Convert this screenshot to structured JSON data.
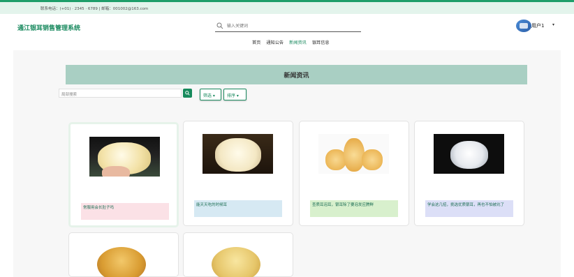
{
  "topbar": {
    "contact": "联系电话：(+01) · 2345 · 6789 | 邮箱：001002@163.com"
  },
  "header": {
    "brand": "通江银耳销售管理系统",
    "search_placeholder": "输入关键词",
    "username": "用户1",
    "caret": "▾"
  },
  "nav": {
    "items": [
      {
        "label": "首页",
        "active": false
      },
      {
        "label": "通知公告",
        "active": false
      },
      {
        "label": "新闻资讯",
        "active": true
      },
      {
        "label": "银耳信息",
        "active": false
      }
    ]
  },
  "page": {
    "title": "新闻资讯",
    "filter_value": "局部搜索",
    "filter_btn": "筛选 ▾",
    "sort_btn": "排序 ▾"
  },
  "cards": [
    {
      "caption": "常服用会长肚子吗",
      "caption_bg": "#fbe1e6",
      "image": "white-fungus-on-hand"
    },
    {
      "caption": "能天天吃的时候耳",
      "caption_bg": "#d6e9f3",
      "image": "white-fungus-dark"
    },
    {
      "caption": "查质耳泡耳，银耳除了要泡发应腾鲜",
      "caption_bg": "#d8f0cd",
      "image": "golden-fungus"
    },
    {
      "caption": "学会这几招，挑选优质银耳，再也不怕被坑了",
      "caption_bg": "#dcdff7",
      "image": "white-fungus-black"
    }
  ],
  "colors": {
    "accent": "#1a8a5f",
    "banner": "#a9cfc3",
    "topbar": "#e3f4ec"
  },
  "icons": {
    "search": "search-icon",
    "user": "avatar"
  }
}
